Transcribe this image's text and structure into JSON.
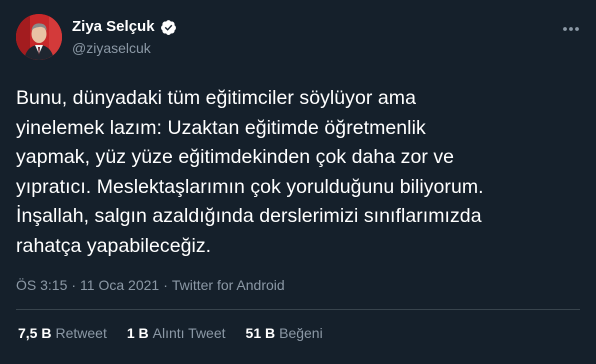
{
  "author": {
    "display_name": "Ziya Selçuk",
    "handle": "@ziyaselcuk",
    "verified": true
  },
  "tweet": {
    "text": "Bunu, dünyadaki tüm eğitimciler söylüyor ama\nyinelemek lazım: Uzaktan eğitimde öğretmenlik\nyapmak, yüz yüze eğitimdekinden çok daha zor ve\nyıpratıcı. Meslektaşlarımın çok yorulduğunu biliyorum.\nİnşallah, salgın azaldığında derslerimizi sınıflarımızda\nrahatça yapabileceğiz."
  },
  "meta": {
    "time": "ÖS 3:15",
    "separator1": "·",
    "date": "11 Oca 2021",
    "separator2": "·",
    "source": "Twitter for Android"
  },
  "stats": [
    {
      "count": "7,5 B",
      "label": "Retweet"
    },
    {
      "count": "1 B",
      "label": "Alıntı Tweet"
    },
    {
      "count": "51 B",
      "label": "Beğeni"
    }
  ],
  "colors": {
    "background": "#15202b",
    "secondary_text": "#8b98a5",
    "verified_badge": "#ffffff",
    "divider": "#38444d"
  },
  "icons": {
    "more": "more-dots-icon",
    "verified": "verified-badge-icon"
  }
}
